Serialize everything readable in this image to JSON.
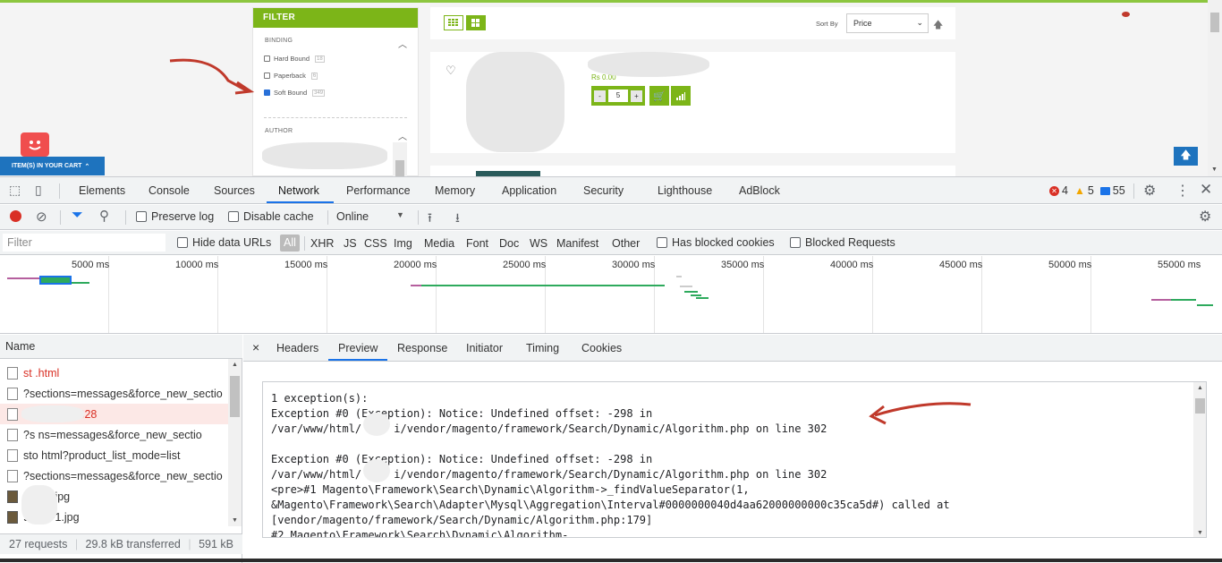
{
  "page": {
    "filter": {
      "title": "FILTER",
      "binding_title": "BINDING",
      "options": [
        {
          "label": "Hard Bound",
          "count": "18",
          "checked": false
        },
        {
          "label": "Paperback",
          "count": "6",
          "checked": false
        },
        {
          "label": "Soft Bound",
          "count": "349",
          "checked": true
        }
      ],
      "author_title": "AUTHOR"
    },
    "sort_label": "Sort By",
    "sort_value": "Price",
    "product": {
      "price": "Rs 0.00",
      "qty": "5",
      "minus": "-",
      "plus": "+"
    },
    "cart_label": "ITEM(S) IN YOUR CART",
    "accent": "#7cb518",
    "cart_color": "#1e73be"
  },
  "devtools": {
    "tabs": [
      "Elements",
      "Console",
      "Sources",
      "Network",
      "Performance",
      "Memory",
      "Application",
      "Security",
      "Lighthouse",
      "AdBlock"
    ],
    "active_tab": "Network",
    "counts": {
      "errors": "4",
      "warnings": "5",
      "messages": "55"
    },
    "toolbar": {
      "preserve_log": "Preserve log",
      "disable_cache": "Disable cache",
      "throttle": "Online"
    },
    "filter": {
      "placeholder": "Filter",
      "hide_data_urls": "Hide data URLs",
      "all": "All",
      "types": [
        "XHR",
        "JS",
        "CSS",
        "Img",
        "Media",
        "Font",
        "Doc",
        "WS",
        "Manifest",
        "Other"
      ],
      "blocked_cookies": "Has blocked cookies",
      "blocked_requests": "Blocked Requests"
    },
    "timeline_ticks": [
      "5000 ms",
      "10000 ms",
      "15000 ms",
      "20000 ms",
      "25000 ms",
      "30000 ms",
      "35000 ms",
      "40000 ms",
      "45000 ms",
      "50000 ms",
      "55000 ms"
    ],
    "name_header": "Name",
    "requests": [
      {
        "name": "st      .html",
        "kind": "doc",
        "status": "error"
      },
      {
        "name": "?sections=messages&force_new_sectio",
        "kind": "doc",
        "status": "ok"
      },
      {
        "name": "           ?binding=7328",
        "kind": "doc",
        "status": "error-selected"
      },
      {
        "name": "?s      ns=messages&force_new_sectio",
        "kind": "doc",
        "status": "ok"
      },
      {
        "name": "sto      html?product_list_mode=list",
        "kind": "doc",
        "status": "ok"
      },
      {
        "name": "?sections=messages&force_new_sectio",
        "kind": "doc",
        "status": "ok"
      },
      {
        "name": "      165-1.jpg",
        "kind": "img",
        "status": "ok"
      },
      {
        "name": "9      394-1.jpg",
        "kind": "img",
        "status": "ok"
      }
    ],
    "summary": {
      "requests": "27 requests",
      "transferred": "29.8 kB transferred",
      "resources": "591 kB"
    },
    "detail_tabs": [
      "Headers",
      "Preview",
      "Response",
      "Initiator",
      "Timing",
      "Cookies"
    ],
    "active_detail_tab": "Preview",
    "close_glyph": "×",
    "preview_lines": [
      "1 exception(s):",
      "Exception #0 (Exception): Notice: Undefined offset: -298 in",
      "/var/www/html/     i/vendor/magento/framework/Search/Dynamic/Algorithm.php on line 302",
      "",
      "Exception #0 (Exception): Notice: Undefined offset: -298 in",
      "/var/www/html/     i/vendor/magento/framework/Search/Dynamic/Algorithm.php on line 302",
      "<pre>#1 Magento\\Framework\\Search\\Dynamic\\Algorithm->_findValueSeparator(1,",
      "&Magento\\Framework\\Search\\Adapter\\Mysql\\Aggregation\\Interval#0000000040d4aa62000000000c35ca5d#) called at",
      "[vendor/magento/framework/Search/Dynamic/Algorithm.php:179]",
      "#2 Magento\\Framework\\Search\\Dynamic\\Algorithm-"
    ]
  }
}
